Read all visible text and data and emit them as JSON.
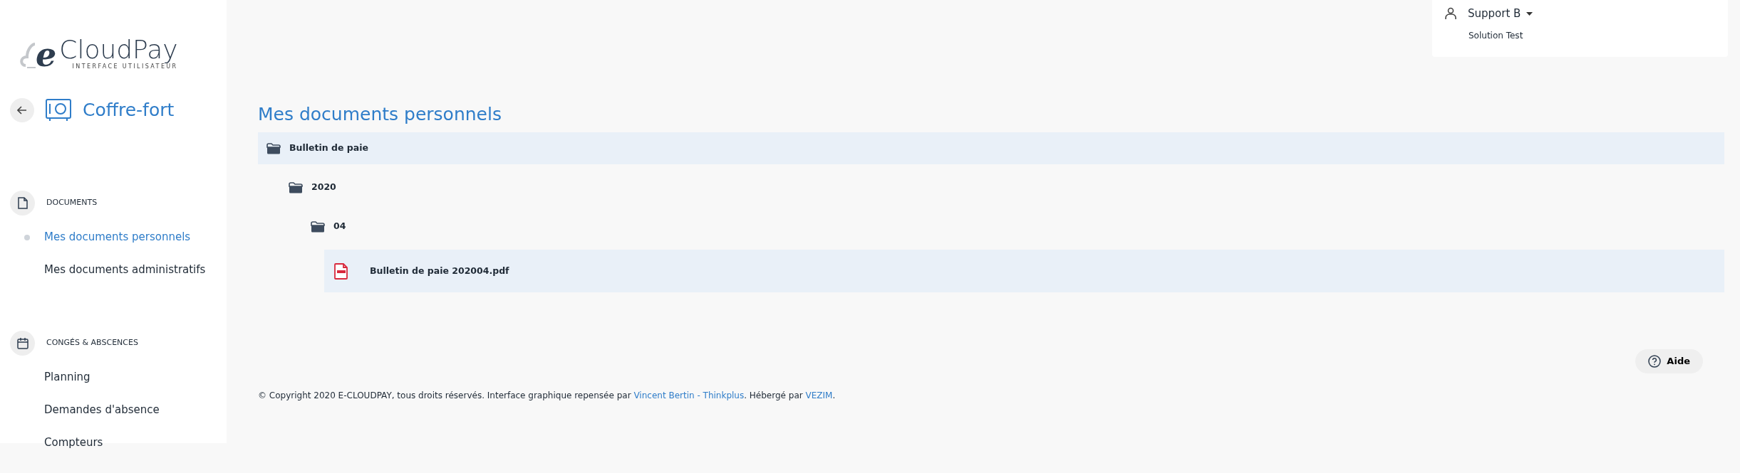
{
  "logo": {
    "letter": "e",
    "name": "CloudPay",
    "tagline": "INTERFACE UTILISATEUR"
  },
  "module": {
    "title": "Coffre-fort"
  },
  "sidebar": {
    "sections": [
      {
        "kind": "documents",
        "title": "DOCUMENTS",
        "items": [
          {
            "label": "Mes documents personnels",
            "selected": true
          },
          {
            "label": "Mes documents administratifs",
            "selected": false
          }
        ]
      },
      {
        "kind": "calendar",
        "title": "CONGÉS & ABSCENCES",
        "items": [
          {
            "label": "Planning",
            "selected": false
          },
          {
            "label": "Demandes d'absence",
            "selected": false
          },
          {
            "label": "Compteurs",
            "selected": false
          }
        ]
      }
    ]
  },
  "user": {
    "name": "Support B",
    "company": "Solution Test"
  },
  "page": {
    "title": "Mes documents personnels"
  },
  "tree": [
    {
      "kind": "folder",
      "label": "Bulletin de paie",
      "selected": true,
      "children": [
        {
          "kind": "folder",
          "label": "2020",
          "selected": false,
          "children": [
            {
              "kind": "folder",
              "label": "04",
              "selected": false,
              "children": [
                {
                  "kind": "file",
                  "label": "Bulletin de paie 202004.pdf",
                  "selected": true
                }
              ]
            }
          ]
        }
      ]
    }
  ],
  "help_button": "Aide",
  "footer": [
    {
      "kind": "text",
      "text": "© Copyright 2020 E-CLOUDPAY, tous droits réservés. Interface graphique repensée par "
    },
    {
      "kind": "link",
      "text": "Vincent Bertin - Thinkplus"
    },
    {
      "kind": "text",
      "text": ". Hébergé par "
    },
    {
      "kind": "link",
      "text": "VEZIM"
    },
    {
      "kind": "text",
      "text": "."
    }
  ]
}
